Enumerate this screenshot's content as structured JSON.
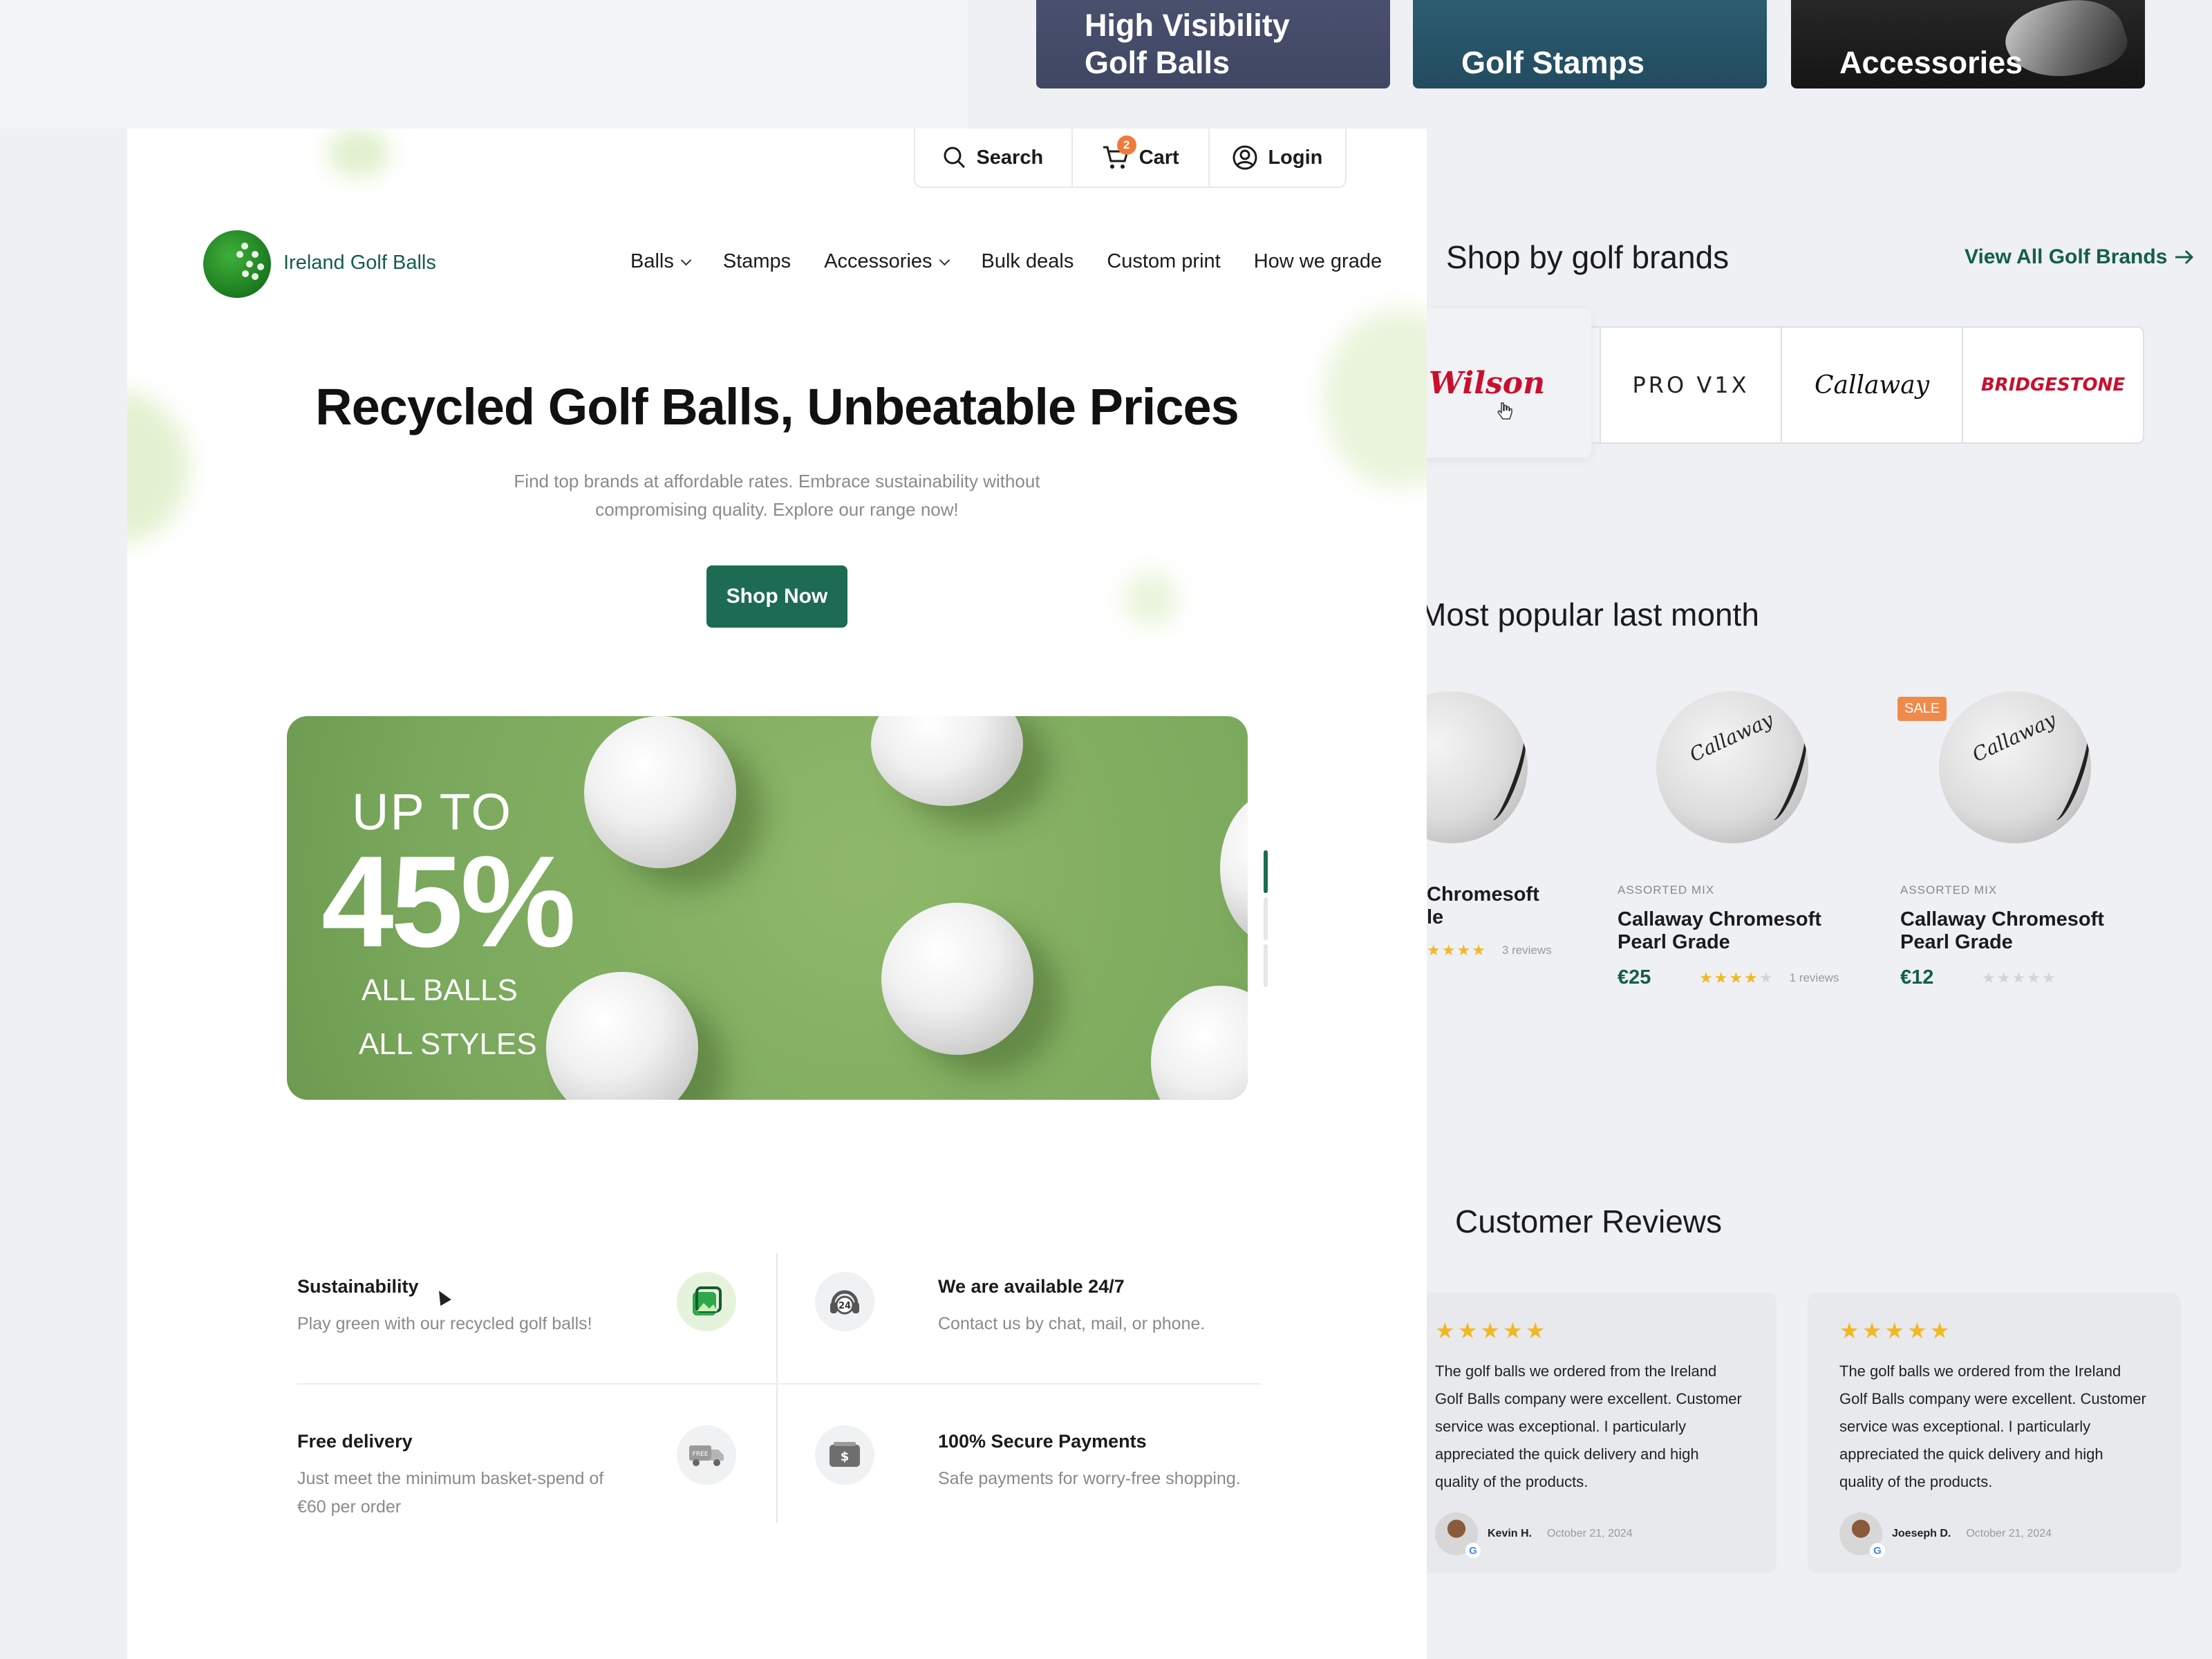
{
  "categories": [
    {
      "line1": "High Visibility",
      "line2": "Golf Balls"
    },
    {
      "line1": "",
      "line2": "Golf Stamps"
    },
    {
      "line1": "",
      "line2": "Accessories"
    }
  ],
  "brands": {
    "title": "Shop by golf brands",
    "view_all": "View All Golf Brands",
    "items": [
      "Wilson",
      "PRO V1X",
      "Callaway",
      "BRIDGESTONE"
    ]
  },
  "popular": {
    "title": "Most popular last month",
    "products": [
      {
        "category": "",
        "name_line1": "Chromesoft",
        "name_line2": "le",
        "price": "",
        "stars": 5,
        "reviews": "3 reviews"
      },
      {
        "category": "ASSORTED MIX",
        "name_line1": "Callaway Chromesoft",
        "name_line2": "Pearl Grade",
        "price": "€25",
        "stars": 4,
        "reviews": "1 reviews"
      },
      {
        "category": "ASSORTED MIX",
        "name_line1": "Callaway Chromesoft",
        "name_line2": "Pearl Grade",
        "price": "€12",
        "stars": 0,
        "reviews": ""
      }
    ],
    "sale_badge": "SALE"
  },
  "reviews": {
    "title": "Customer Reviews",
    "items": [
      {
        "text": "The golf balls we ordered from the Ireland Golf Balls company were excellent. Customer service was exceptional. I particularly appreciated the quick delivery and high quality of the products.",
        "name": "Kevin H.",
        "date": "October 21, 2024"
      },
      {
        "text": "The golf balls we ordered from the Ireland Golf Balls company were excellent. Customer service was exceptional. I particularly appreciated the quick delivery and high quality of the products.",
        "name": "Joeseph D.",
        "date": "October 21, 2024"
      }
    ]
  },
  "topbar": {
    "search": "Search",
    "cart": "Cart",
    "cart_count": "2",
    "login": "Login"
  },
  "brand_name": "Ireland Golf Balls",
  "nav": [
    "Balls",
    "Stamps",
    "Accessories",
    "Bulk deals",
    "Custom print",
    "How we grade"
  ],
  "hero": {
    "title": "Recycled Golf Balls, Unbeatable Prices",
    "subtitle": "Find top brands at affordable rates. Embrace sustainability without compromising quality. Explore our range now!",
    "cta": "Shop Now"
  },
  "promo": {
    "line_a": "UP TO",
    "percent": "45%",
    "line_b": "ALL BALLS",
    "line_c": "ALL STYLES",
    "active_slide": 1,
    "slides": 3
  },
  "features": [
    {
      "title": "Sustainability",
      "desc": "Play green with our recycled golf balls!",
      "icon": "recycle-image-icon"
    },
    {
      "title": "We are available 24/7",
      "desc": "Contact us by chat, mail, or phone.",
      "icon": "support-24-icon"
    },
    {
      "title": "Free delivery",
      "desc": "Just meet the minimum basket-spend of €60 per order",
      "icon": "delivery-truck-icon"
    },
    {
      "title": "100% Secure Payments",
      "desc": "Safe payments for worry-free shopping.",
      "icon": "secure-payment-icon"
    }
  ],
  "colors": {
    "brand_green": "#1d6b53",
    "accent_orange": "#f07a3a",
    "star_yellow": "#f2b824"
  }
}
